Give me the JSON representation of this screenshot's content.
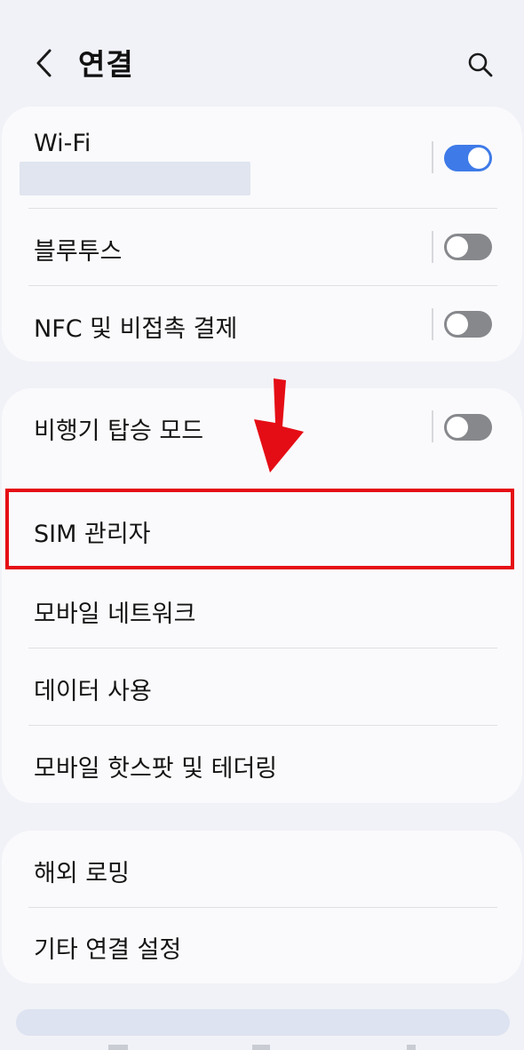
{
  "header": {
    "title": "연결",
    "back_icon": "chevron-left-icon",
    "search_icon": "search-icon"
  },
  "cards": [
    {
      "items": [
        {
          "label": "Wi-Fi",
          "toggle": true,
          "subtitle_blurred": true
        },
        {
          "label": "블루투스",
          "toggle": false
        },
        {
          "label": "NFC 및 비접촉 결제",
          "toggle": false
        }
      ]
    },
    {
      "items": [
        {
          "label": "비행기 탑승 모드",
          "toggle": false
        },
        {
          "label": "SIM 관리자"
        },
        {
          "label": "모바일 네트워크"
        },
        {
          "label": "데이터 사용"
        },
        {
          "label": "모바일 핫스팟 및 테더링"
        }
      ]
    },
    {
      "items": [
        {
          "label": "해외 로밍"
        },
        {
          "label": "기타 연결 설정"
        }
      ]
    }
  ],
  "annotation": {
    "highlight_color": "#e50d15",
    "arrow_icon": "down-arrow-icon"
  },
  "colors": {
    "toggle_on": "#3e7ae8",
    "toggle_off": "#86888c",
    "background": "#f1f2f7",
    "card": "#fafafc"
  }
}
